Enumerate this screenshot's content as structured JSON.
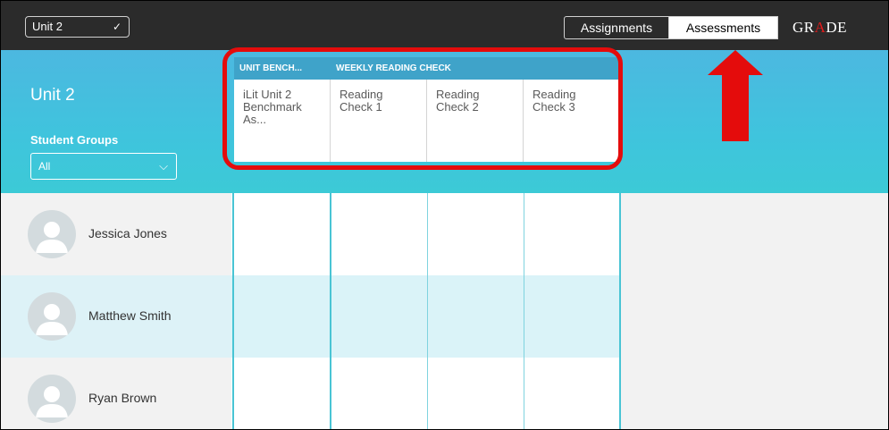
{
  "topbar": {
    "unit_select": "Unit 2",
    "tabs": [
      "Assignments",
      "Assessments"
    ],
    "grade": {
      "gr": "GR",
      "a": "A",
      "de": "DE"
    }
  },
  "header": {
    "title": "Unit 2",
    "groups_label": "Student Groups",
    "group_value": "All"
  },
  "assessments": {
    "categories": [
      "UNIT BENCH...",
      "WEEKLY READING CHECK"
    ],
    "columns": [
      {
        "line1": "iLit Unit 2",
        "line2": "Benchmark",
        "line3": "As..."
      },
      {
        "line1": "Reading",
        "line2": "Check 1"
      },
      {
        "line1": "Reading",
        "line2": "Check 2"
      },
      {
        "line1": "Reading",
        "line2": "Check 3"
      }
    ]
  },
  "students": [
    "Jessica Jones",
    "Matthew Smith",
    "Ryan Brown"
  ],
  "colors": {
    "topbar": "#2b2b2b",
    "band": "#4cb8e0",
    "category_strip": "#3fa3c9",
    "annotation": "#e40c0c"
  }
}
